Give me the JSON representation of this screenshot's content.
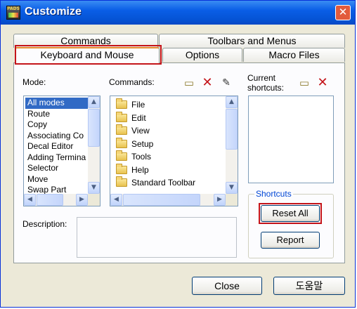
{
  "window": {
    "title": "Customize",
    "icon_text": "PADS"
  },
  "tabs": {
    "row1": [
      {
        "label": "Commands"
      },
      {
        "label": "Toolbars and Menus"
      }
    ],
    "row2": [
      {
        "label": "Keyboard and Mouse",
        "active": true
      },
      {
        "label": "Options"
      },
      {
        "label": "Macro Files"
      }
    ]
  },
  "mode": {
    "label": "Mode:",
    "items": [
      "All modes",
      "Route",
      "Copy",
      "Associating Co",
      "Decal Editor",
      "Adding Termina",
      "Selector",
      "Move",
      "Swap Part"
    ],
    "selected_index": 0
  },
  "commands": {
    "label": "Commands:",
    "items": [
      "File",
      "Edit",
      "View",
      "Setup",
      "Tools",
      "Help",
      "Standard Toolbar"
    ]
  },
  "shortcuts": {
    "label_line1": "Current",
    "label_line2": "shortcuts:",
    "group_title": "Shortcuts",
    "reset_all": "Reset All",
    "report": "Report"
  },
  "description": {
    "label": "Description:"
  },
  "footer": {
    "close": "Close",
    "help": "도움말"
  },
  "colors": {
    "highlight": "#c4141a",
    "selection": "#316ac5",
    "titlebar": "#0a5ee6"
  }
}
